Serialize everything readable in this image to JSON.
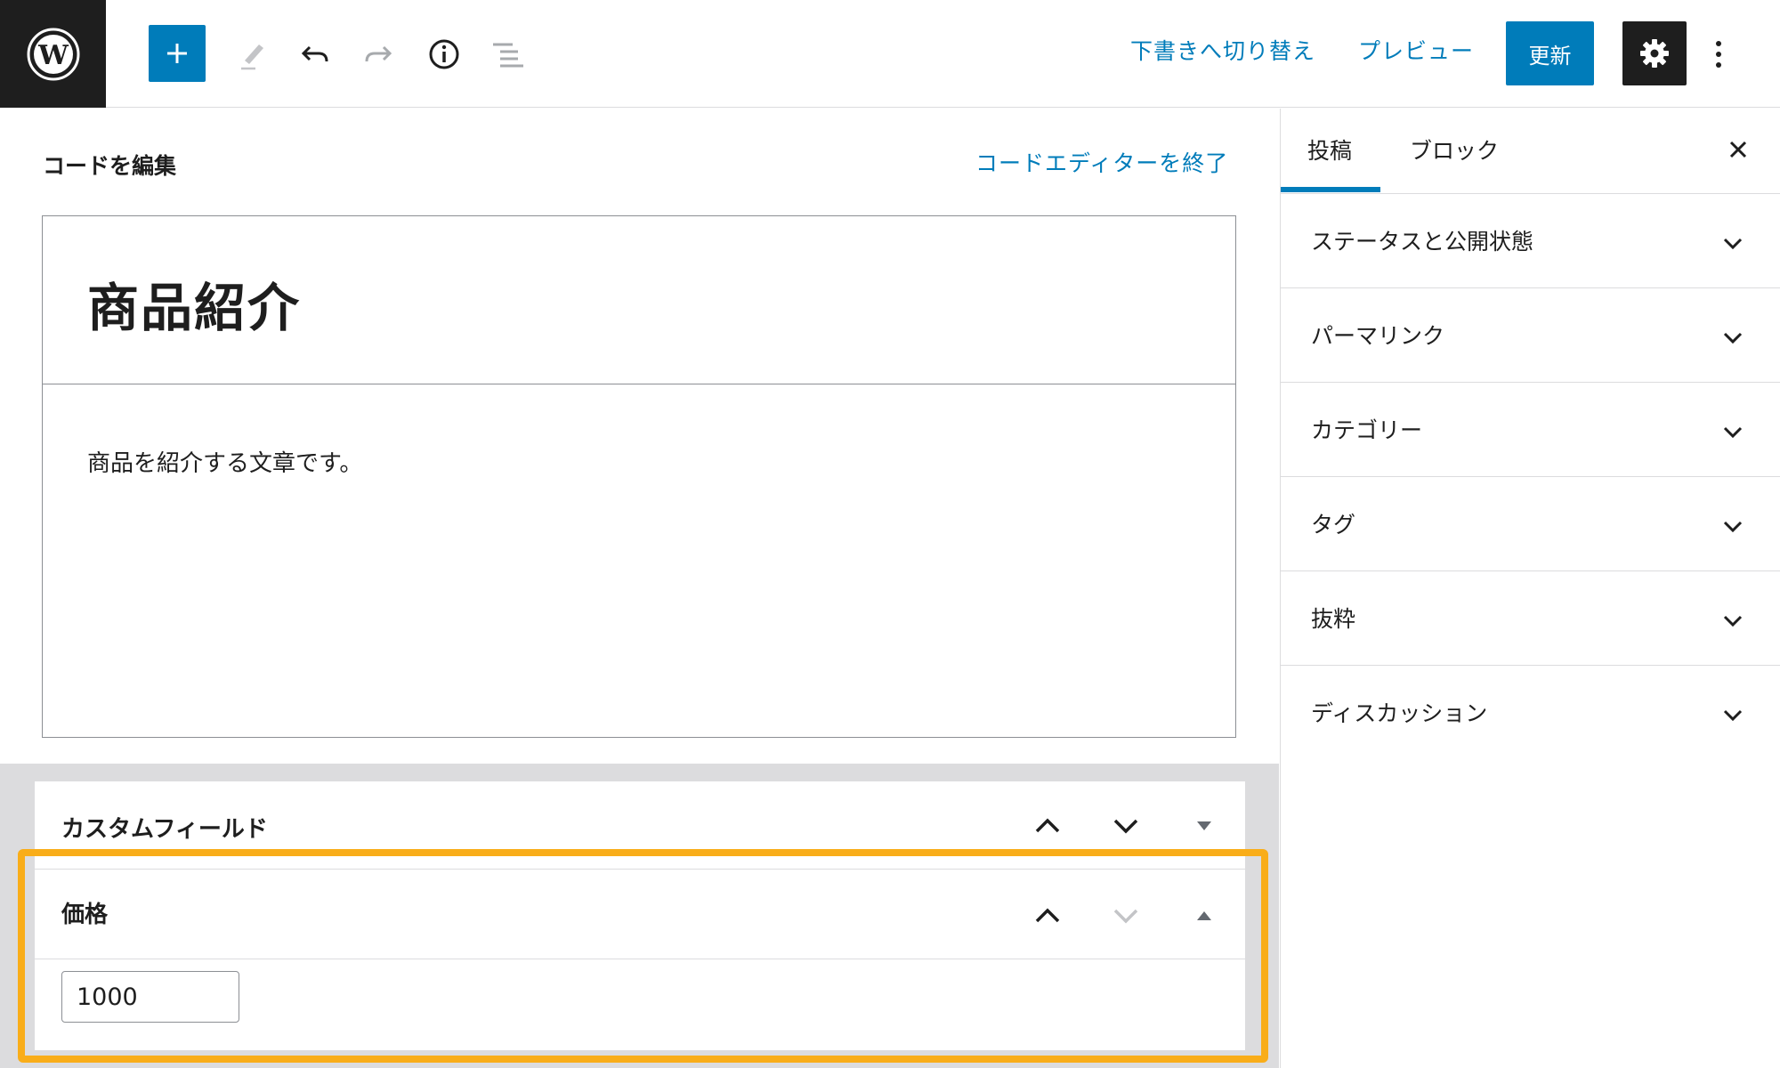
{
  "toolbar": {
    "add_block": "add-block",
    "tools": [
      "pencil-icon",
      "undo-icon",
      "redo-icon",
      "info-icon",
      "list-view-icon"
    ],
    "switch_to_draft": "下書きへ切り替え",
    "preview": "プレビュー",
    "update": "更新"
  },
  "editor": {
    "code_heading": "コードを編集",
    "exit_code_editor": "コードエディターを終了",
    "post_title": "商品紹介",
    "post_content": "商品を紹介する文章です。"
  },
  "meta_boxes": {
    "custom_fields": {
      "title": "カスタムフィールド"
    },
    "price": {
      "title": "価格",
      "value": "1000"
    }
  },
  "sidebar": {
    "tabs": [
      {
        "label": "投稿",
        "active": true
      },
      {
        "label": "ブロック",
        "active": false
      }
    ],
    "panels": [
      {
        "label": "ステータスと公開状態"
      },
      {
        "label": "パーマリンク"
      },
      {
        "label": "カテゴリー"
      },
      {
        "label": "タグ"
      },
      {
        "label": "抜粋"
      },
      {
        "label": "ディスカッション"
      }
    ]
  },
  "colors": {
    "accent": "#007cba",
    "dark": "#1e1e1e",
    "highlight": "#f9ad19",
    "meta_background": "#dcdcde"
  }
}
